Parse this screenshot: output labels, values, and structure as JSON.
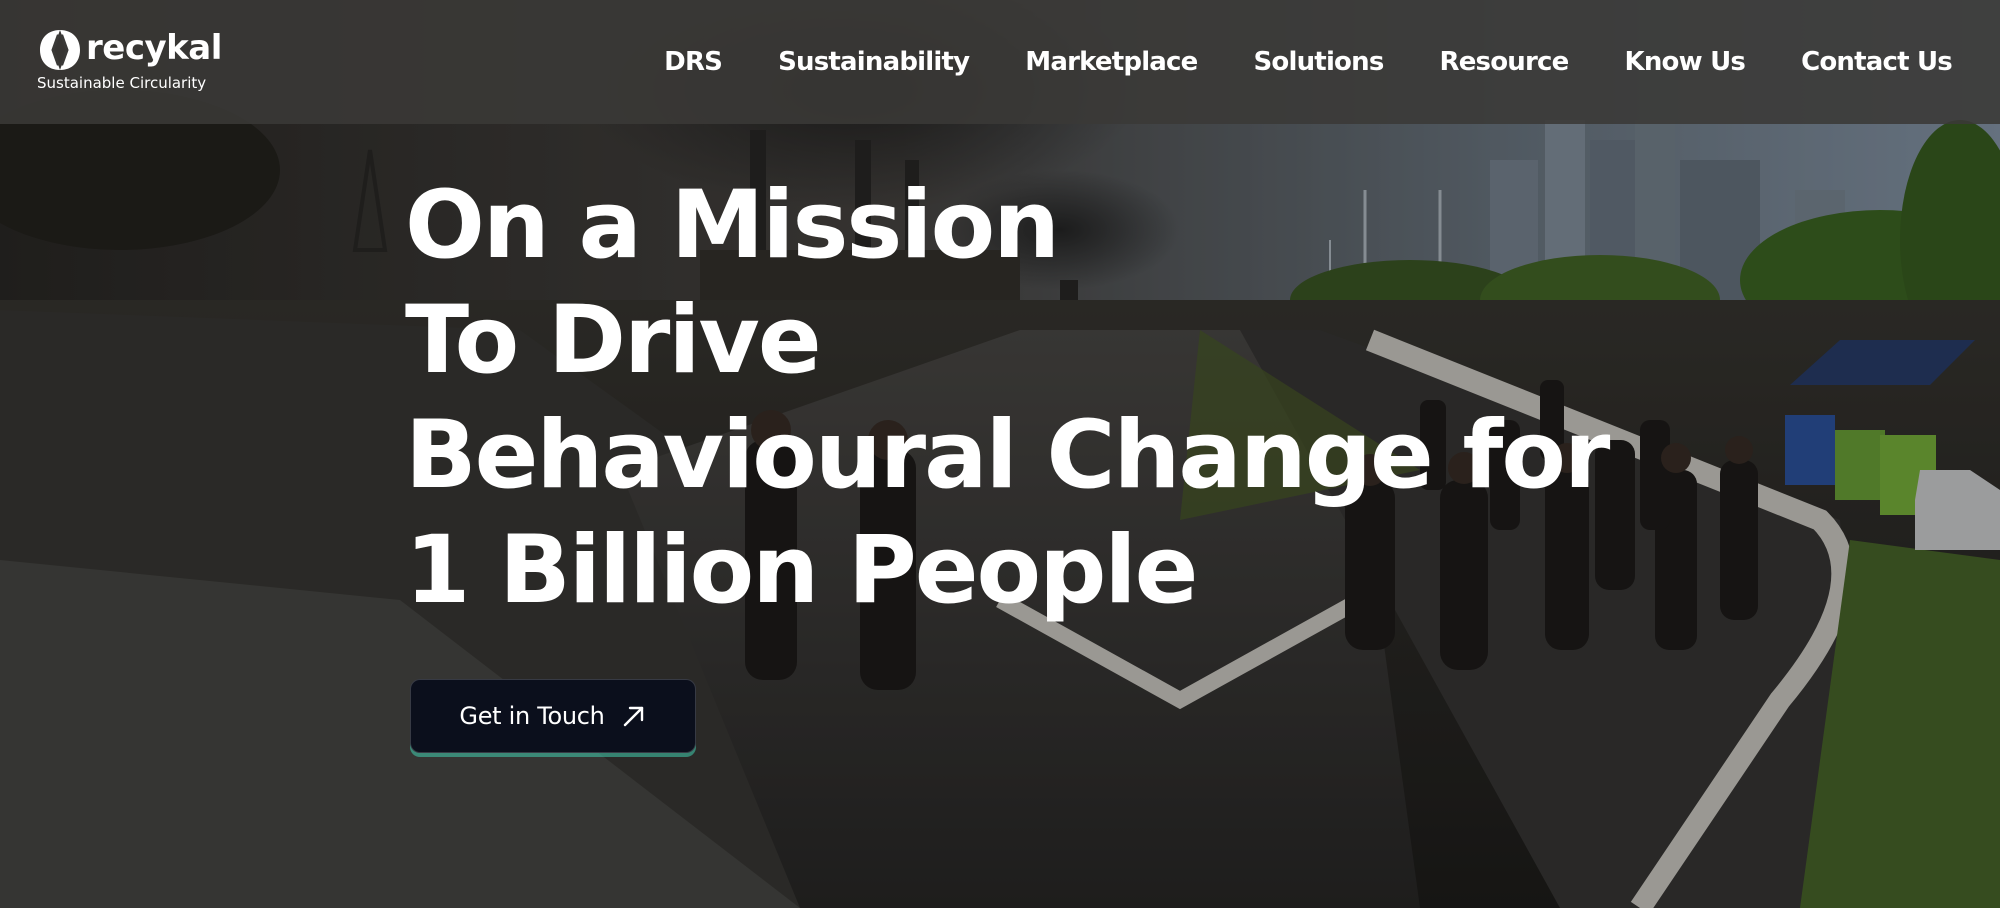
{
  "brand": {
    "name": "recykal",
    "tagline": "Sustainable Circularity",
    "logo_icon": "recykal-logo-mark"
  },
  "nav": {
    "items": [
      {
        "label": "DRS"
      },
      {
        "label": "Sustainability"
      },
      {
        "label": "Marketplace"
      },
      {
        "label": "Solutions"
      },
      {
        "label": "Resource"
      },
      {
        "label": "Know Us"
      },
      {
        "label": "Contact Us"
      }
    ]
  },
  "hero": {
    "headline_lines": [
      "On a Mission",
      "To Drive",
      "Behavioural Change for",
      "1 Billion People"
    ],
    "cta": {
      "label": "Get in Touch",
      "icon": "arrow-up-right-icon"
    }
  },
  "colors": {
    "navbar_bg": "#3a3937",
    "cta_bg": "#0b0f1c",
    "cta_accent": "#3fcdaf",
    "text": "#ffffff"
  }
}
